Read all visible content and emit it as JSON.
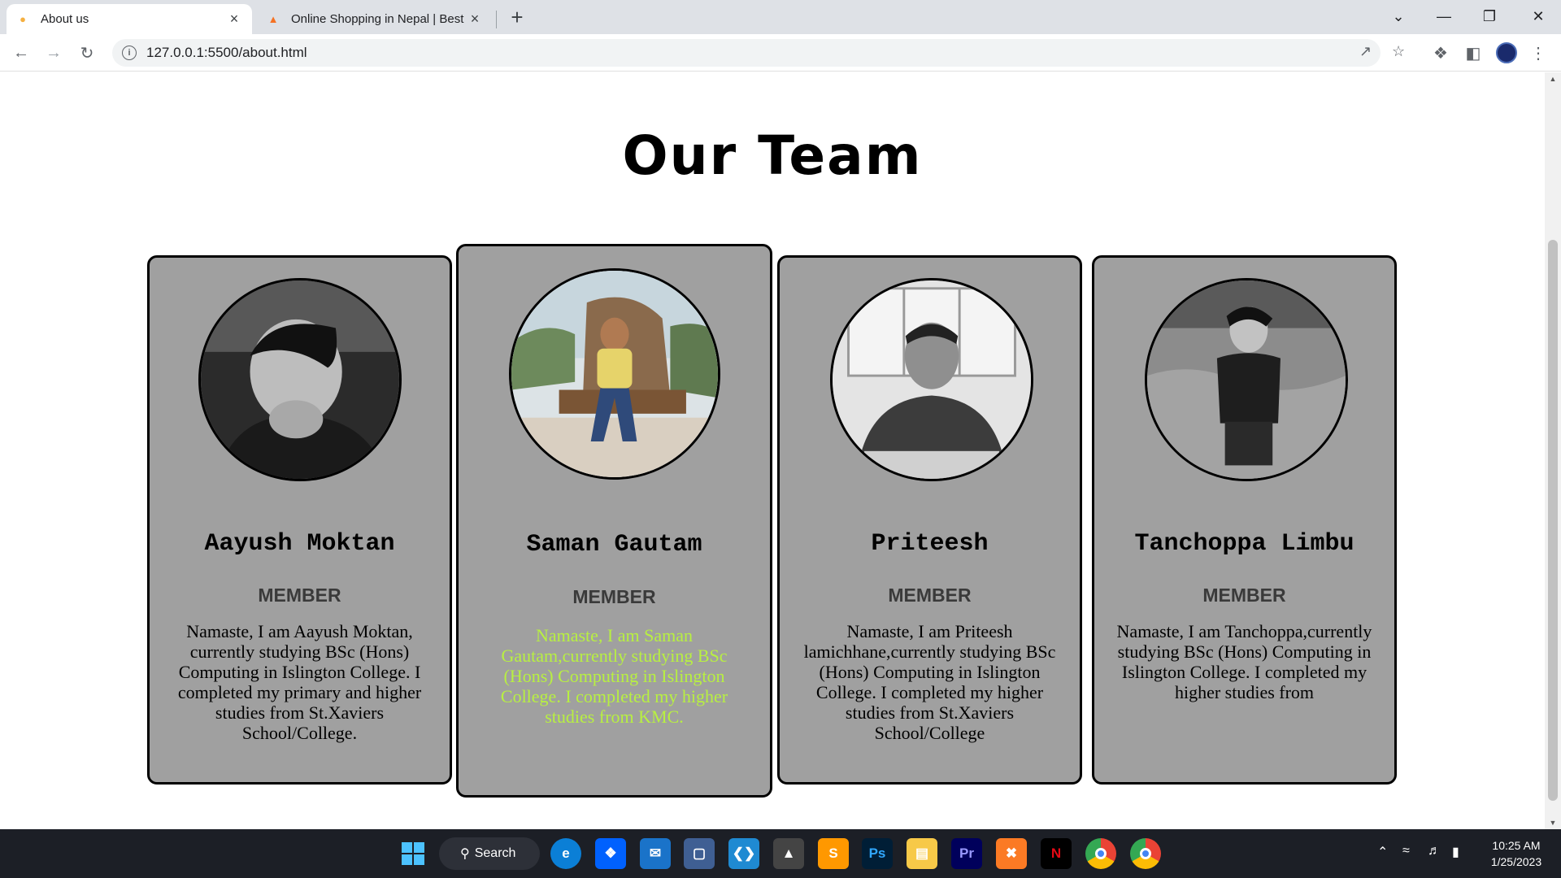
{
  "browser": {
    "tabs": [
      {
        "title": "About us",
        "active": true
      },
      {
        "title": "Online Shopping in Nepal | Best f",
        "active": false
      }
    ],
    "url": "127.0.0.1:5500/about.html"
  },
  "page": {
    "title": "Our Team",
    "members": [
      {
        "name": "Aayush Moktan",
        "role": "MEMBER",
        "bio": "Namaste, I am Aayush Moktan, currently studying BSc (Hons) Computing in Islington College. I completed my primary and higher studies from St.Xaviers School/College."
      },
      {
        "name": "Saman Gautam",
        "role": "MEMBER",
        "bio": "Namaste, I am Saman Gautam,currently studying BSc (Hons) Computing in Islington College. I completed my higher studies from KMC."
      },
      {
        "name": "Priteesh",
        "role": "MEMBER",
        "bio": "Namaste, I am Priteesh lamichhane,currently studying BSc (Hons) Computing in Islington College. I completed my higher studies from St.Xaviers School/College"
      },
      {
        "name": "Tanchoppa Limbu",
        "role": "MEMBER",
        "bio": "Namaste, I am Tanchoppa,currently studying BSc (Hons) Computing in Islington College. I completed my higher studies from"
      }
    ],
    "highlight_color": "#b8f041"
  },
  "taskbar": {
    "search_label": "Search",
    "time": "10:25 AM",
    "date": "1/25/2023",
    "apps": [
      "edge-icon",
      "dropbox-icon",
      "mail-icon",
      "virtualbox-icon",
      "vscode-icon",
      "inkscape-icon",
      "sublime-icon",
      "photoshop-icon",
      "file-explorer-icon",
      "premiere-icon",
      "xampp-icon",
      "netflix-icon",
      "chrome-icon",
      "chrome-profile-icon"
    ]
  }
}
